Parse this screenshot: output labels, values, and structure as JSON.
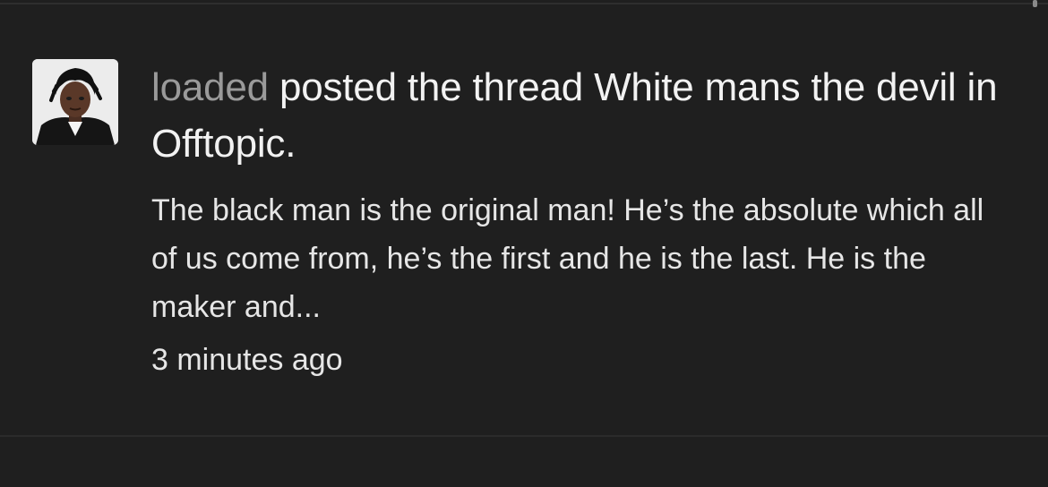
{
  "activity": {
    "username": "loaded",
    "action_text": "posted the thread",
    "thread_title": "White mans the devil",
    "in_text": "in",
    "forum_name": "Offtopic",
    "end_punctuation": ".",
    "snippet": "The black man is the original man! He’s the absolute which all of us come from, he’s the first and he is the last. He is the maker and...",
    "timestamp": "3 minutes ago"
  },
  "colors": {
    "background": "#1f1f1f",
    "username": "#9a9a9a",
    "text": "#f2f2f2"
  },
  "icons": {
    "avatar": "user-avatar-photo"
  }
}
